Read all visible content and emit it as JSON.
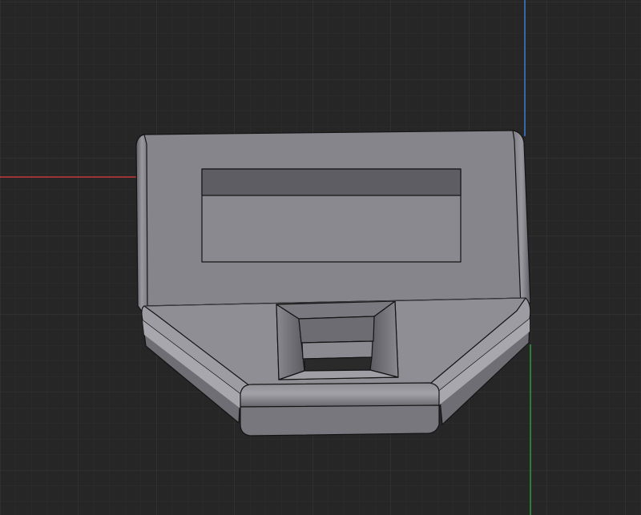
{
  "viewport": {
    "view": "top",
    "background_color": "#262626",
    "grid_minor_color": "#2e2e2e",
    "grid_major_color": "#383838",
    "axis_x_color": "#c0393b",
    "axis_y_color": "#3d7fd6",
    "axis_y_lower_color": "#2f9a3a"
  },
  "model": {
    "body_color": "#8d8c92",
    "top_face_color": "#86858b",
    "side_face_color": "#6e6d73",
    "edge_color": "#141414",
    "slot_inner_color": "#5b5a60",
    "hole_through_color": "#2a2a2a"
  }
}
